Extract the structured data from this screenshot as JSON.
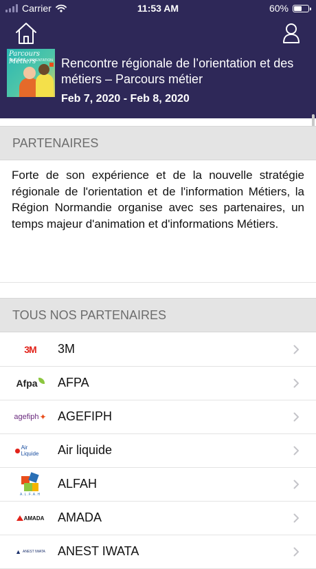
{
  "status_bar": {
    "carrier": "Carrier",
    "time": "11:53 AM",
    "battery": "60%",
    "battery_level": 0.6
  },
  "header": {
    "event_title": "Rencontre régionale de l’orientation et des métiers – Parcours métier",
    "event_dates": "Feb 7, 2020 - Feb 8, 2020",
    "thumbnail_title": "Parcours Métiers",
    "thumbnail_subtitle": "SALON DE L'ORIENTATION"
  },
  "sections": {
    "partners_title": "PARTENAIRES",
    "partners_intro": "Forte de son expérience et de la nouvelle stratégie régionale de l'orientation et de l'information Métiers, la Région Normandie organise avec ses partenaires, un temps majeur d'animation et d'informations Métiers.",
    "all_partners_title": "TOUS NOS PARTENAIRES"
  },
  "partners": [
    {
      "name": "3M",
      "logo_text": "3M",
      "logo_color": "#e2231a"
    },
    {
      "name": "AFPA",
      "logo_text": "Afpa",
      "logo_color": "#222222"
    },
    {
      "name": "AGEFIPH",
      "logo_text": "agefiph",
      "logo_color": "#6a2a7e"
    },
    {
      "name": "Air liquide",
      "logo_text": "Air Liquide",
      "logo_color": "#1b4fa0"
    },
    {
      "name": "ALFAH",
      "logo_text": "A.L.F.A.H",
      "logo_color": "#2a6fb5"
    },
    {
      "name": "AMADA",
      "logo_text": "AMADA",
      "logo_color": "#111111"
    },
    {
      "name": "ANEST IWATA",
      "logo_text": "ANEST IWATA",
      "logo_color": "#1a2f6b"
    }
  ],
  "colors": {
    "header_bg": "#2e2858",
    "section_bg": "#e4e4e4",
    "chevron": "#c4c4c9"
  }
}
